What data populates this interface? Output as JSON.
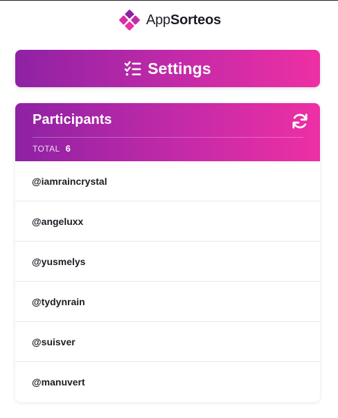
{
  "brand": {
    "name_light": "App",
    "name_bold": "Sorteos",
    "logo_icon": "appsorteos-logo-icon"
  },
  "settings_button": {
    "label": "Settings",
    "icon": "checklist-icon"
  },
  "participants": {
    "title": "Participants",
    "refresh_icon": "refresh-icon",
    "total_label": "TOTAL",
    "total_value": "6",
    "items": [
      "@iamraincrystal",
      "@angeluxx",
      "@yusmelys",
      "@tydynrain",
      "@suisver",
      "@manuvert"
    ]
  },
  "colors": {
    "gradient_start": "#8e22a4",
    "gradient_end": "#ee2fa4",
    "text_dark": "#1c1c24"
  }
}
